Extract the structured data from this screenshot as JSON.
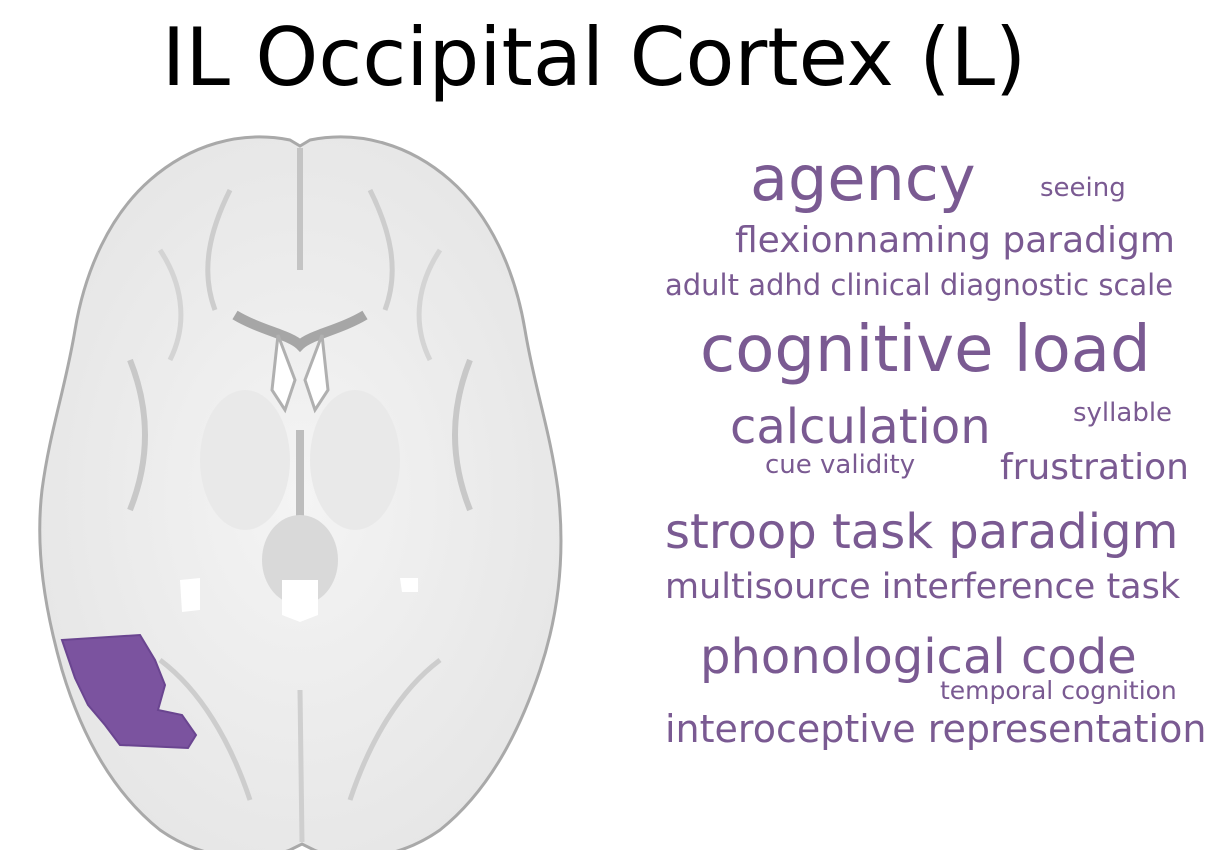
{
  "title": "IL Occipital Cortex (L)",
  "colors": {
    "highlight": "#7b539f",
    "word": "#7a5a92",
    "brain_fill": "#f2f2f2",
    "brain_line": "#b5b5b5"
  },
  "words": [
    {
      "text": "agency"
    },
    {
      "text": "seeing"
    },
    {
      "text": "flexionnaming paradigm"
    },
    {
      "text": "adult adhd clinical diagnostic scale"
    },
    {
      "text": "cognitive load"
    },
    {
      "text": "calculation"
    },
    {
      "text": "syllable"
    },
    {
      "text": "cue validity"
    },
    {
      "text": "frustration"
    },
    {
      "text": "stroop task paradigm"
    },
    {
      "text": "multisource interference task"
    },
    {
      "text": "phonological code"
    },
    {
      "text": "temporal cognition"
    },
    {
      "text": "interoceptive representation"
    }
  ]
}
